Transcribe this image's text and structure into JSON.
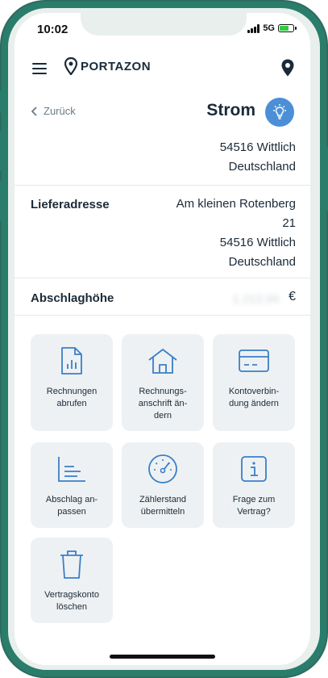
{
  "status": {
    "time": "10:02",
    "network": "5G"
  },
  "header": {
    "logo": "PORTAZON"
  },
  "nav": {
    "back_label": "Zurück",
    "title": "Strom"
  },
  "billing_address_tail": {
    "line1": "54516 Wittlich",
    "line2": "Deutschland"
  },
  "delivery": {
    "label": "Lieferadresse",
    "lines": [
      "Am kleinen Rotenberg",
      "21",
      "54516 Wittlich",
      "Deutschland"
    ]
  },
  "installment": {
    "label": "Abschlaghöhe",
    "value": "1.212,00",
    "currency": "€"
  },
  "tiles": [
    {
      "label": "Rechnungen\nabrufen",
      "icon": "invoice-chart-icon"
    },
    {
      "label": "Rechnungs-\nanschrift än-\ndern",
      "icon": "house-icon"
    },
    {
      "label": "Kontoverbin-\ndung ändern",
      "icon": "credit-card-icon"
    },
    {
      "label": "Abschlag an-\npassen",
      "icon": "bar-list-icon"
    },
    {
      "label": "Zählerstand\nübermitteln",
      "icon": "gauge-icon"
    },
    {
      "label": "Frage zum\nVertrag?",
      "icon": "info-icon"
    },
    {
      "label": "Vertragskonto\nlöschen",
      "icon": "trash-icon"
    }
  ],
  "colors": {
    "accent": "#2a7d6b",
    "icon_blue": "#3a7fc8",
    "bulb_bg": "#4b8fd6"
  }
}
